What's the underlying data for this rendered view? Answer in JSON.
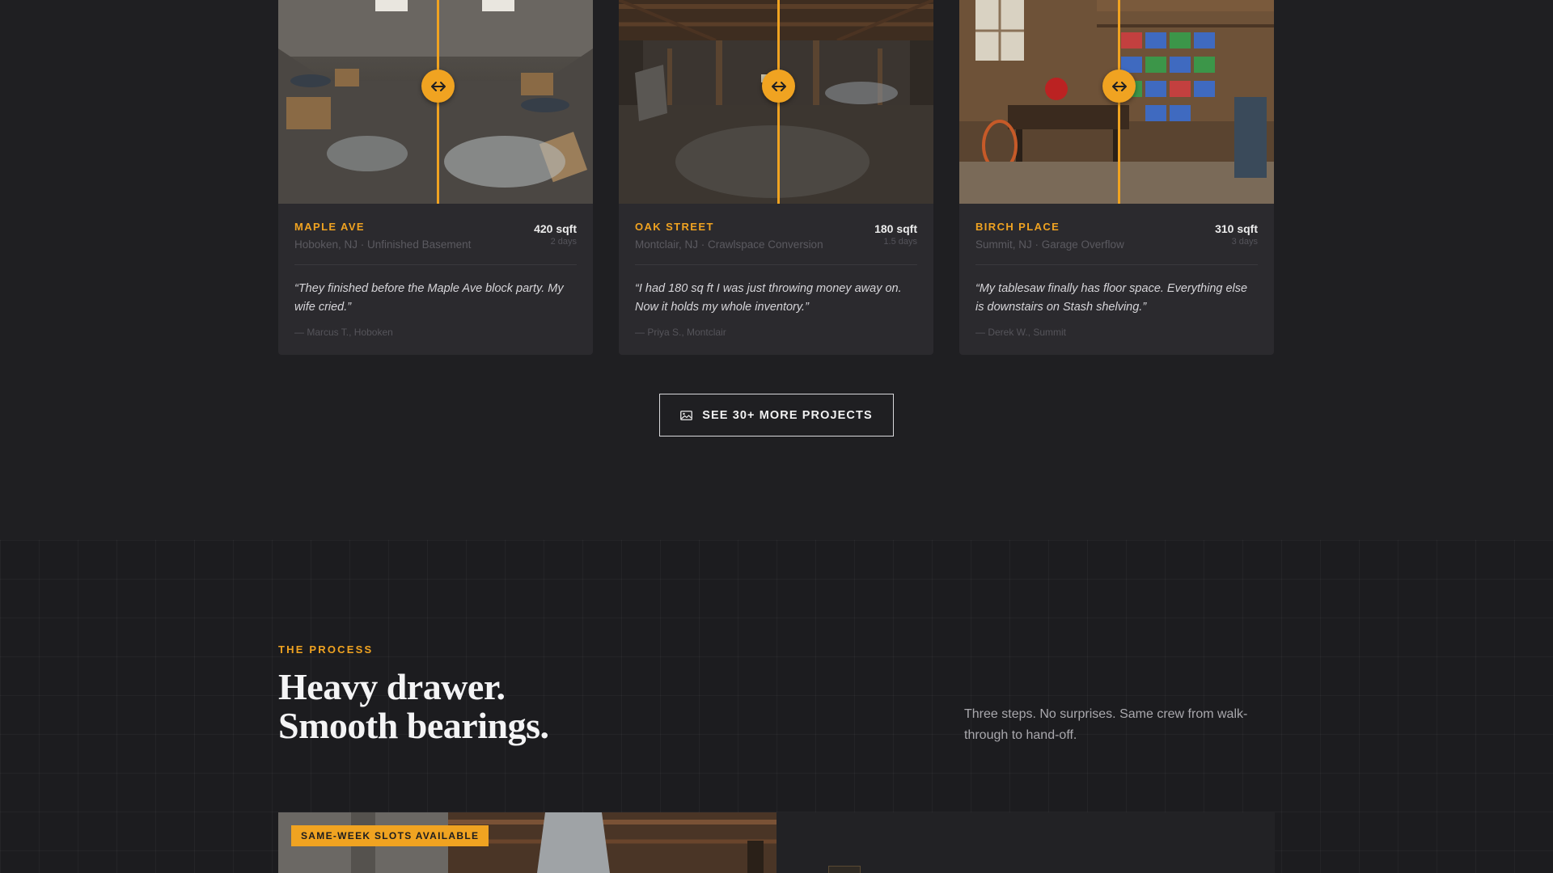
{
  "colors": {
    "accent": "#f0a321",
    "background": "#1f1f22",
    "card": "#2b2a2e"
  },
  "projects": [
    {
      "street": "MAPLE AVE",
      "location": "Hoboken, NJ · Unfinished Basement",
      "size": "420 sqft",
      "duration": "2 days",
      "quote": "“They finished before the Maple Ave block party. My wife cried.”",
      "author": "— Marcus T., Hoboken",
      "handle_icon": "drag-arrows-icon"
    },
    {
      "street": "OAK STREET",
      "location": "Montclair, NJ · Crawlspace Conversion",
      "size": "180 sqft",
      "duration": "1.5 days",
      "quote": "“I had 180 sq ft I was just throwing money away on. Now it holds my whole inventory.”",
      "author": "— Priya S., Montclair",
      "handle_icon": "drag-arrows-icon"
    },
    {
      "street": "BIRCH PLACE",
      "location": "Summit, NJ · Garage Overflow",
      "size": "310 sqft",
      "duration": "3 days",
      "quote": "“My tablesaw finally has floor space. Everything else is downstairs on Stash shelving.”",
      "author": "— Derek W., Summit",
      "handle_icon": "drag-arrows-icon"
    }
  ],
  "cta": {
    "label": "SEE 30+ MORE PROJECTS",
    "icon": "gallery-icon"
  },
  "process": {
    "eyebrow": "THE PROCESS",
    "headline_line1": "Heavy drawer.",
    "headline_line2": "Smooth bearings.",
    "lede": "Three steps. No surprises. Same crew from walk-through to hand-off.",
    "badge": "SAME-WEEK SLOTS AVAILABLE"
  }
}
